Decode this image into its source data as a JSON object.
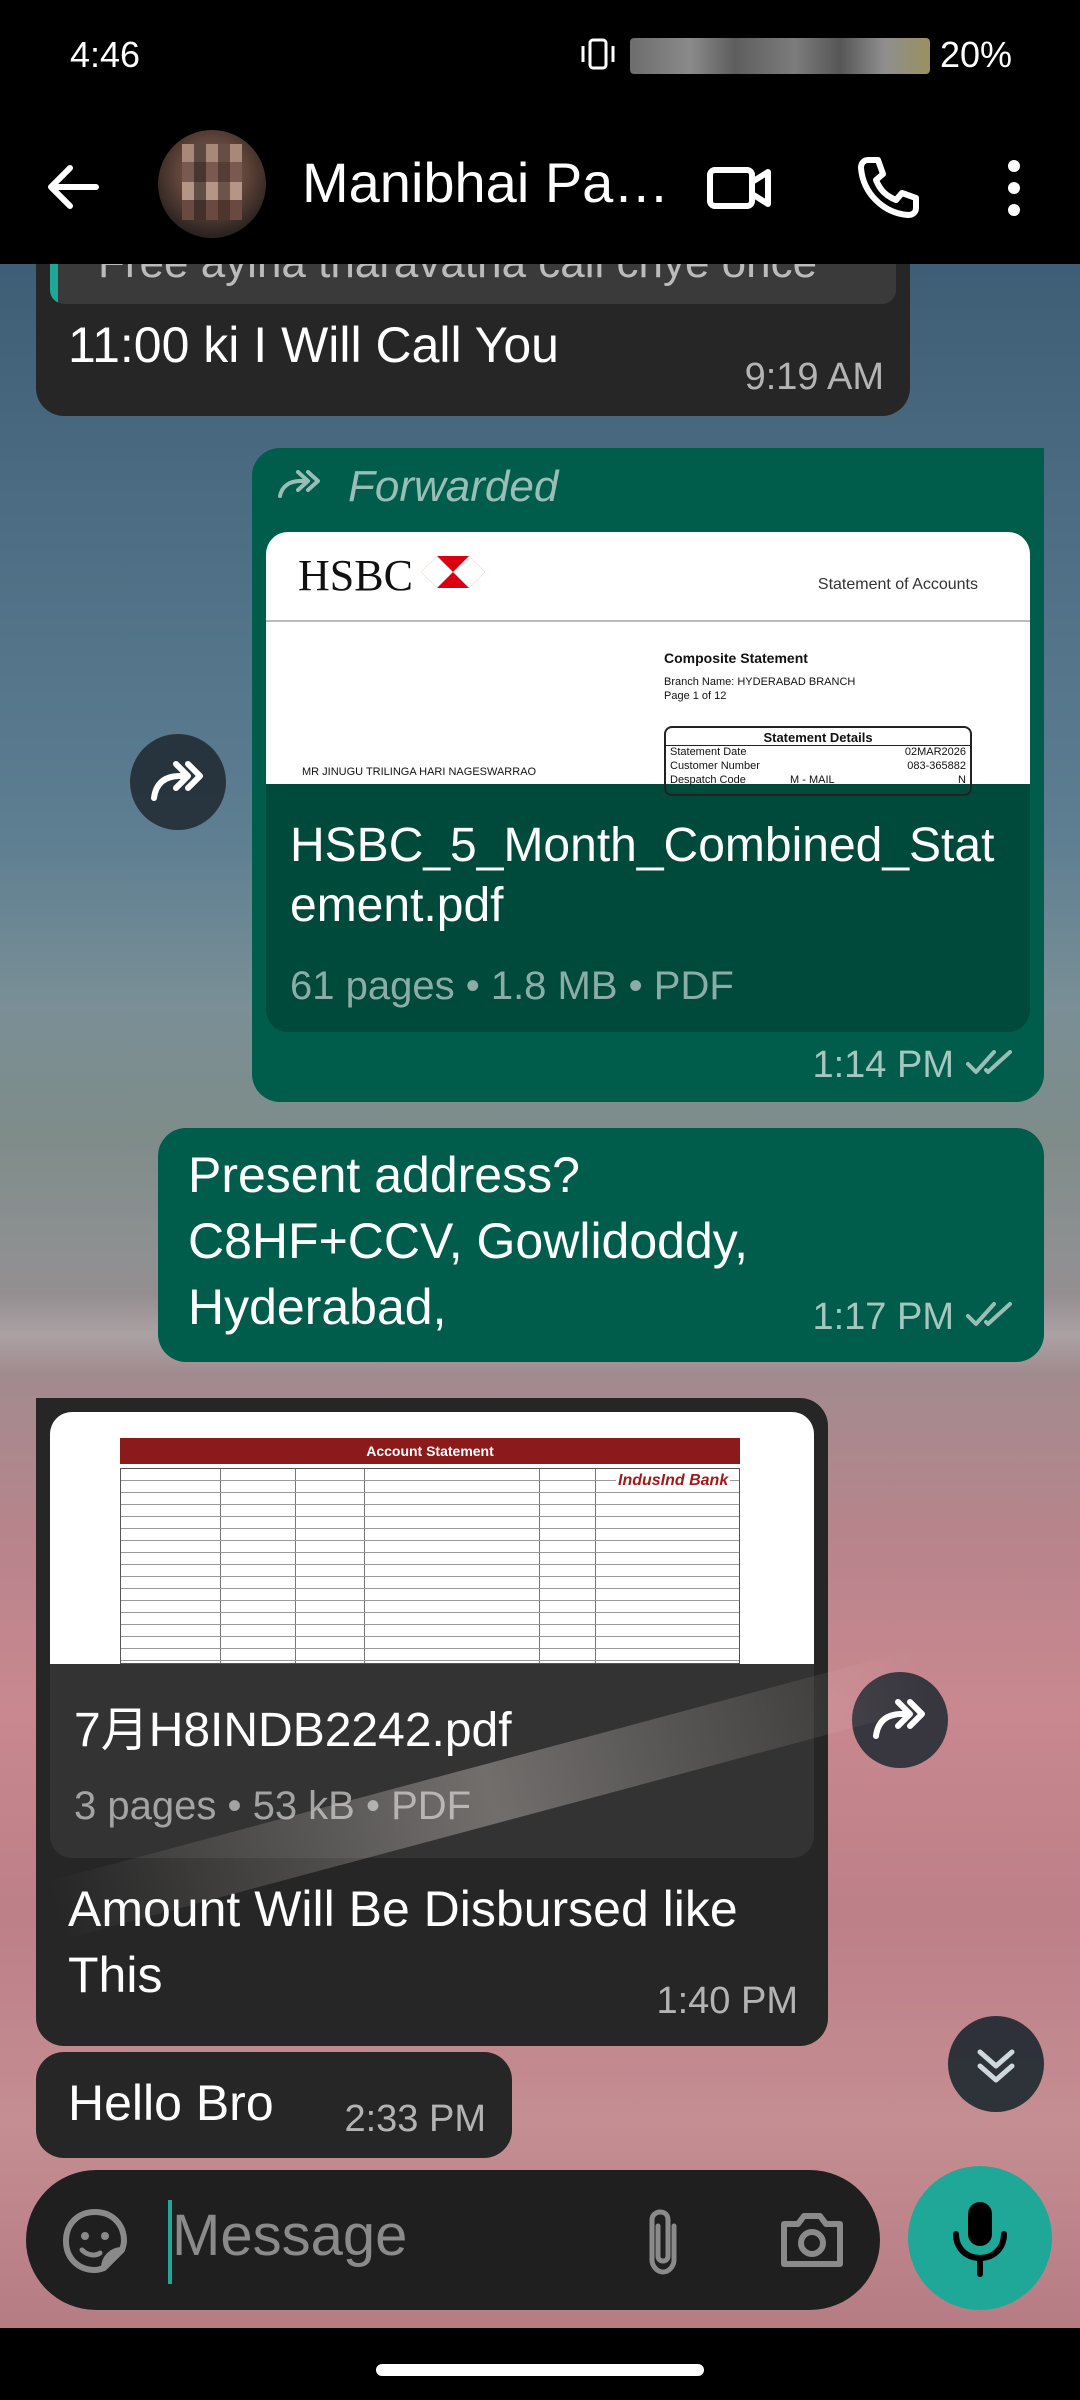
{
  "status_bar": {
    "time": "4:46",
    "battery": "20%"
  },
  "header": {
    "contact_name": "Manibhai Pa…"
  },
  "messages": {
    "m1": {
      "quoted_text": "Free ayina tharavatha call chye once",
      "text": "11:00 ki I Will Call You",
      "time": "9:19 AM"
    },
    "m2": {
      "forwarded_label": "Forwarded",
      "preview": {
        "bank_name": "HSBC",
        "statement_title": "Statement of Accounts",
        "composite": "Composite Statement",
        "branch": "Branch Name: HYDERABAD BRANCH",
        "page": "Page 1 of 12",
        "details_title": "Statement Details",
        "row1_label": "Statement Date",
        "row1_value": "02MAR2026",
        "row2_label": "Customer Number",
        "row2_value": "083-365882",
        "row3_label": "Despatch Code",
        "row3_mid": "M - MAIL",
        "row3_value": "N",
        "holder": "MR JINUGU TRILINGA HARI NAGESWARRAO"
      },
      "file_name": "HSBC_5_Month_Combined_Statement.pdf",
      "file_meta": "61 pages • 1.8 MB • PDF",
      "time": "1:14 PM"
    },
    "m3": {
      "line1": "Present address?",
      "line2": "C8HF+CCV, Gowlidoddy,",
      "line3": "Hyderabad,",
      "time": "1:17 PM"
    },
    "m4": {
      "preview": {
        "title": "Account Statement",
        "bank": "IndusInd Bank"
      },
      "file_name": "7月H8INDB2242.pdf",
      "file_meta": "3 pages • 53 kB • PDF",
      "text_line1": "Amount Will Be Disbursed like",
      "text_line2": "This",
      "time": "1:40 PM"
    },
    "m5": {
      "text": "Hello Bro",
      "time": "2:33 PM"
    }
  },
  "compose": {
    "placeholder": "Message"
  },
  "colors": {
    "outgoing": "#005c4b",
    "incoming": "#262626",
    "accent": "#1fa897"
  },
  "icons": [
    "back-arrow-icon",
    "video-call-icon",
    "phone-icon",
    "more-vert-icon",
    "forward-icon",
    "double-check-icon",
    "scroll-down-icon",
    "sticker-icon",
    "attach-icon",
    "camera-icon",
    "mic-icon"
  ]
}
